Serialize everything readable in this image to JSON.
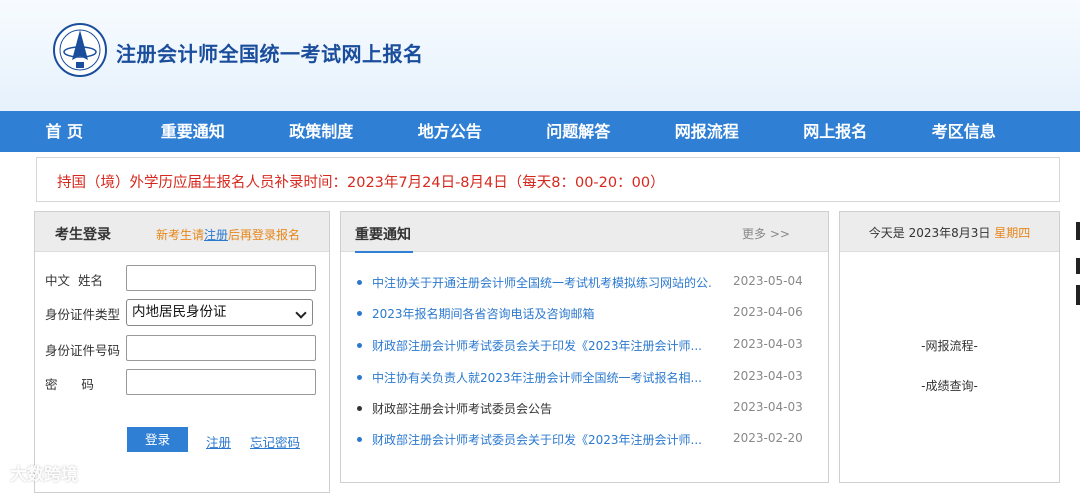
{
  "site": {
    "title": "注册会计师全国统一考试网上报名",
    "logo_icon": "cicpa-emblem-icon"
  },
  "nav": {
    "items": [
      {
        "label": "首 页"
      },
      {
        "label": "重要通知"
      },
      {
        "label": "政策制度"
      },
      {
        "label": "地方公告"
      },
      {
        "label": "问题解答"
      },
      {
        "label": "网报流程"
      },
      {
        "label": "网上报名"
      },
      {
        "label": "考区信息"
      }
    ]
  },
  "notice": {
    "text": "持国（境）外学历应届生报名人员补录时间：2023年7月24日-8月4日（每天8：00-20：00）"
  },
  "login": {
    "title": "考生登录",
    "note_prefix": "新考生请",
    "note_link": "注册",
    "note_suffix": "后再登录报名",
    "fields": {
      "name_label": "中文  姓名",
      "name_value": "",
      "id_type_label": "身份证件类型",
      "id_type_value": "内地居民身份证",
      "id_number_label": "身份证件号码",
      "id_number_value": "",
      "password_label": "密      码",
      "password_value": ""
    },
    "login_button": "登录",
    "register_link": "注册",
    "forgot_link": "忘记密码"
  },
  "news": {
    "title": "重要通知",
    "more": "更多 >>",
    "items": [
      {
        "title": "中注协关于开通注册会计师全国统一考试机考模拟练习网站的公...",
        "date": "2023-05-04"
      },
      {
        "title": "2023年报名期间各省咨询电话及咨询邮箱",
        "date": "2023-04-06"
      },
      {
        "title": "财政部注册会计师考试委员会关于印发《2023年注册会计师...",
        "date": "2023-04-03"
      },
      {
        "title": "中注协有关负责人就2023年注册会计师全国统一考试报名相...",
        "date": "2023-04-03"
      },
      {
        "title": "财政部注册会计师考试委员会公告",
        "date": "2023-04-03"
      },
      {
        "title": "财政部注册会计师考试委员会关于印发《2023年注册会计师...",
        "date": "2023-02-20"
      }
    ]
  },
  "today": {
    "prefix": "今天是 2023年8月3日 ",
    "weekday": "星期四"
  },
  "side_links": {
    "flow": "-网报流程-",
    "score": "-成绩查询-"
  },
  "watermark": "大数跨境",
  "colors": {
    "nav_bg": "#2f7fd4",
    "title_blue": "#1a4e9c",
    "notice_red": "#d7281d",
    "accent_orange": "#e8861a",
    "link_blue": "#2b79cf"
  }
}
